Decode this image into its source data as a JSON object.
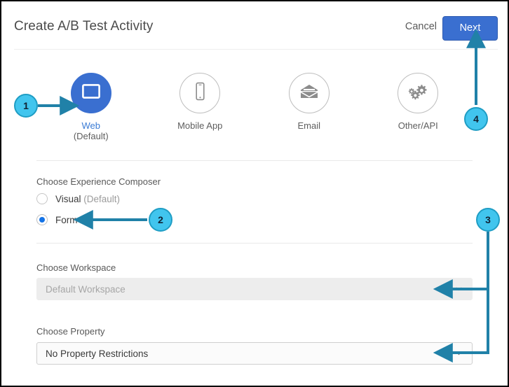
{
  "header": {
    "title": "Create A/B Test Activity",
    "cancel_label": "Cancel",
    "next_label": "Next"
  },
  "channels": [
    {
      "label": "Web",
      "sublabel": "(Default)",
      "icon": "browser-window-icon",
      "selected": true
    },
    {
      "label": "Mobile App",
      "sublabel": "",
      "icon": "mobile-phone-icon",
      "selected": false
    },
    {
      "label": "Email",
      "sublabel": "",
      "icon": "open-envelope-icon",
      "selected": false
    },
    {
      "label": "Other/API",
      "sublabel": "",
      "icon": "gears-icon",
      "selected": false
    }
  ],
  "composer": {
    "label": "Choose Experience Composer",
    "options": [
      {
        "label": "Visual",
        "hint": " (Default)",
        "checked": false
      },
      {
        "label": "Form",
        "hint": "",
        "checked": true
      }
    ]
  },
  "workspace": {
    "label": "Choose Workspace",
    "value": "Default Workspace",
    "disabled": true
  },
  "property": {
    "label": "Choose Property",
    "value": "No Property Restrictions",
    "disabled": false
  },
  "annotations": [
    {
      "id": "1",
      "label": "1",
      "target": "web-channel"
    },
    {
      "id": "2",
      "label": "2",
      "target": "form-radio"
    },
    {
      "id": "3",
      "label": "3",
      "target": "workspace-and-property-fields"
    },
    {
      "id": "4",
      "label": "4",
      "target": "next-button"
    }
  ],
  "colors": {
    "accent_blue": "#3a6fd0",
    "link_blue": "#3a7bd5",
    "annotation_cyan": "#41c5ee",
    "annotation_arrow": "#2081a8",
    "radio_selected": "#1473e6"
  }
}
